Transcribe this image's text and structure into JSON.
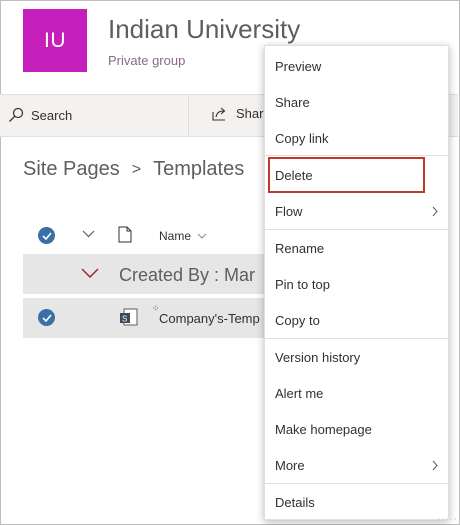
{
  "site": {
    "initials": "IU",
    "title": "Indian University",
    "subtitle": "Private group",
    "logo_color": "#c51fbb"
  },
  "commandbar": {
    "search_label": "Search",
    "share_label": "Share"
  },
  "breadcrumb": {
    "parent": "Site Pages",
    "separator": ">",
    "current": "Templates"
  },
  "list": {
    "column_name": "Name",
    "group_label": "Created By : Mar",
    "item_name": "Company's-Temp",
    "item_spark": "⁘"
  },
  "context_menu": {
    "items": [
      {
        "label": "Preview"
      },
      {
        "label": "Share"
      },
      {
        "label": "Copy link"
      },
      {
        "label": "Delete",
        "highlighted": true
      },
      {
        "label": "Flow",
        "has_submenu": true
      },
      {
        "label": "Rename"
      },
      {
        "label": "Pin to top"
      },
      {
        "label": "Copy to"
      },
      {
        "label": "Version history"
      },
      {
        "label": "Alert me"
      },
      {
        "label": "Make homepage"
      },
      {
        "label": "More",
        "has_submenu": true
      },
      {
        "label": "Details"
      }
    ]
  },
  "colors": {
    "accent": "#3b6fa8",
    "highlight_border": "#c0392b",
    "selected_row": "#e6e6e6"
  },
  "icons": [
    "search-icon",
    "share-icon",
    "check-circle-icon",
    "chevron-down-icon",
    "document-icon",
    "page-file-icon",
    "chevron-right-icon"
  ]
}
